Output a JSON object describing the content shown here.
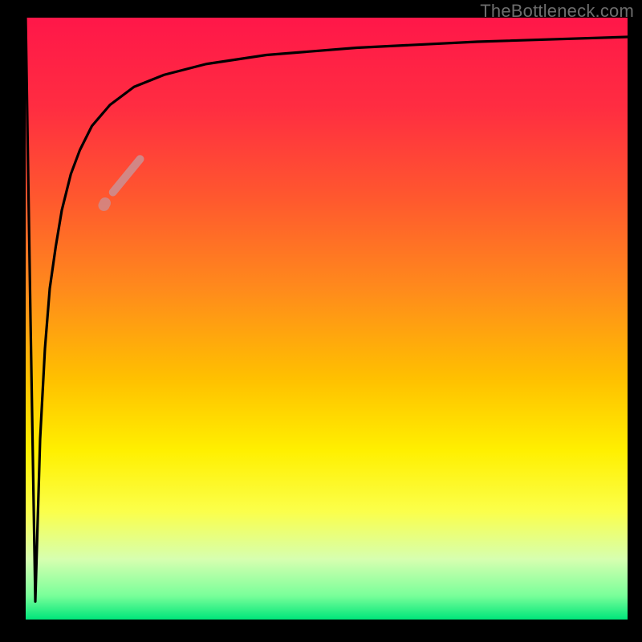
{
  "watermark": {
    "text": "TheBottleneck.com",
    "top": 1,
    "right": 10
  },
  "gradient": {
    "stops": [
      {
        "offset": 0.0,
        "color": "#ff1749"
      },
      {
        "offset": 0.15,
        "color": "#ff2d41"
      },
      {
        "offset": 0.3,
        "color": "#ff582e"
      },
      {
        "offset": 0.45,
        "color": "#ff8a1c"
      },
      {
        "offset": 0.6,
        "color": "#ffc000"
      },
      {
        "offset": 0.72,
        "color": "#fff000"
      },
      {
        "offset": 0.82,
        "color": "#fbff4a"
      },
      {
        "offset": 0.9,
        "color": "#d6ffb0"
      },
      {
        "offset": 0.96,
        "color": "#7aff9a"
      },
      {
        "offset": 1.0,
        "color": "#00e57a"
      }
    ]
  },
  "chart_data": {
    "type": "line",
    "title": "",
    "xlabel": "",
    "ylabel": "",
    "xlim": [
      0,
      100
    ],
    "ylim": [
      0,
      100
    ],
    "grid": false,
    "series": [
      {
        "name": "bottleneck-curve",
        "x": [
          0.0,
          0.8,
          1.6,
          2.4,
          3.2,
          4.0,
          5.0,
          6.0,
          7.5,
          9.0,
          11.0,
          14.0,
          18.0,
          23.0,
          30.0,
          40.0,
          55.0,
          75.0,
          100.0
        ],
        "values": [
          100.0,
          50.0,
          3.0,
          30.0,
          45.0,
          55.0,
          62.0,
          68.0,
          74.0,
          78.0,
          82.0,
          85.5,
          88.5,
          90.5,
          92.3,
          93.8,
          95.0,
          96.0,
          96.8
        ]
      }
    ],
    "markers": [
      {
        "name": "highlight-segment",
        "color": "#d08a8a",
        "opacity": 0.95,
        "width": 10,
        "x": [
          14.5,
          19.0
        ],
        "values": [
          71.0,
          76.5
        ]
      },
      {
        "name": "highlight-dot",
        "color": "#d08a8a",
        "opacity": 0.85,
        "width": 14,
        "x": [
          13.0,
          13.2
        ],
        "values": [
          68.8,
          69.2
        ]
      }
    ]
  }
}
